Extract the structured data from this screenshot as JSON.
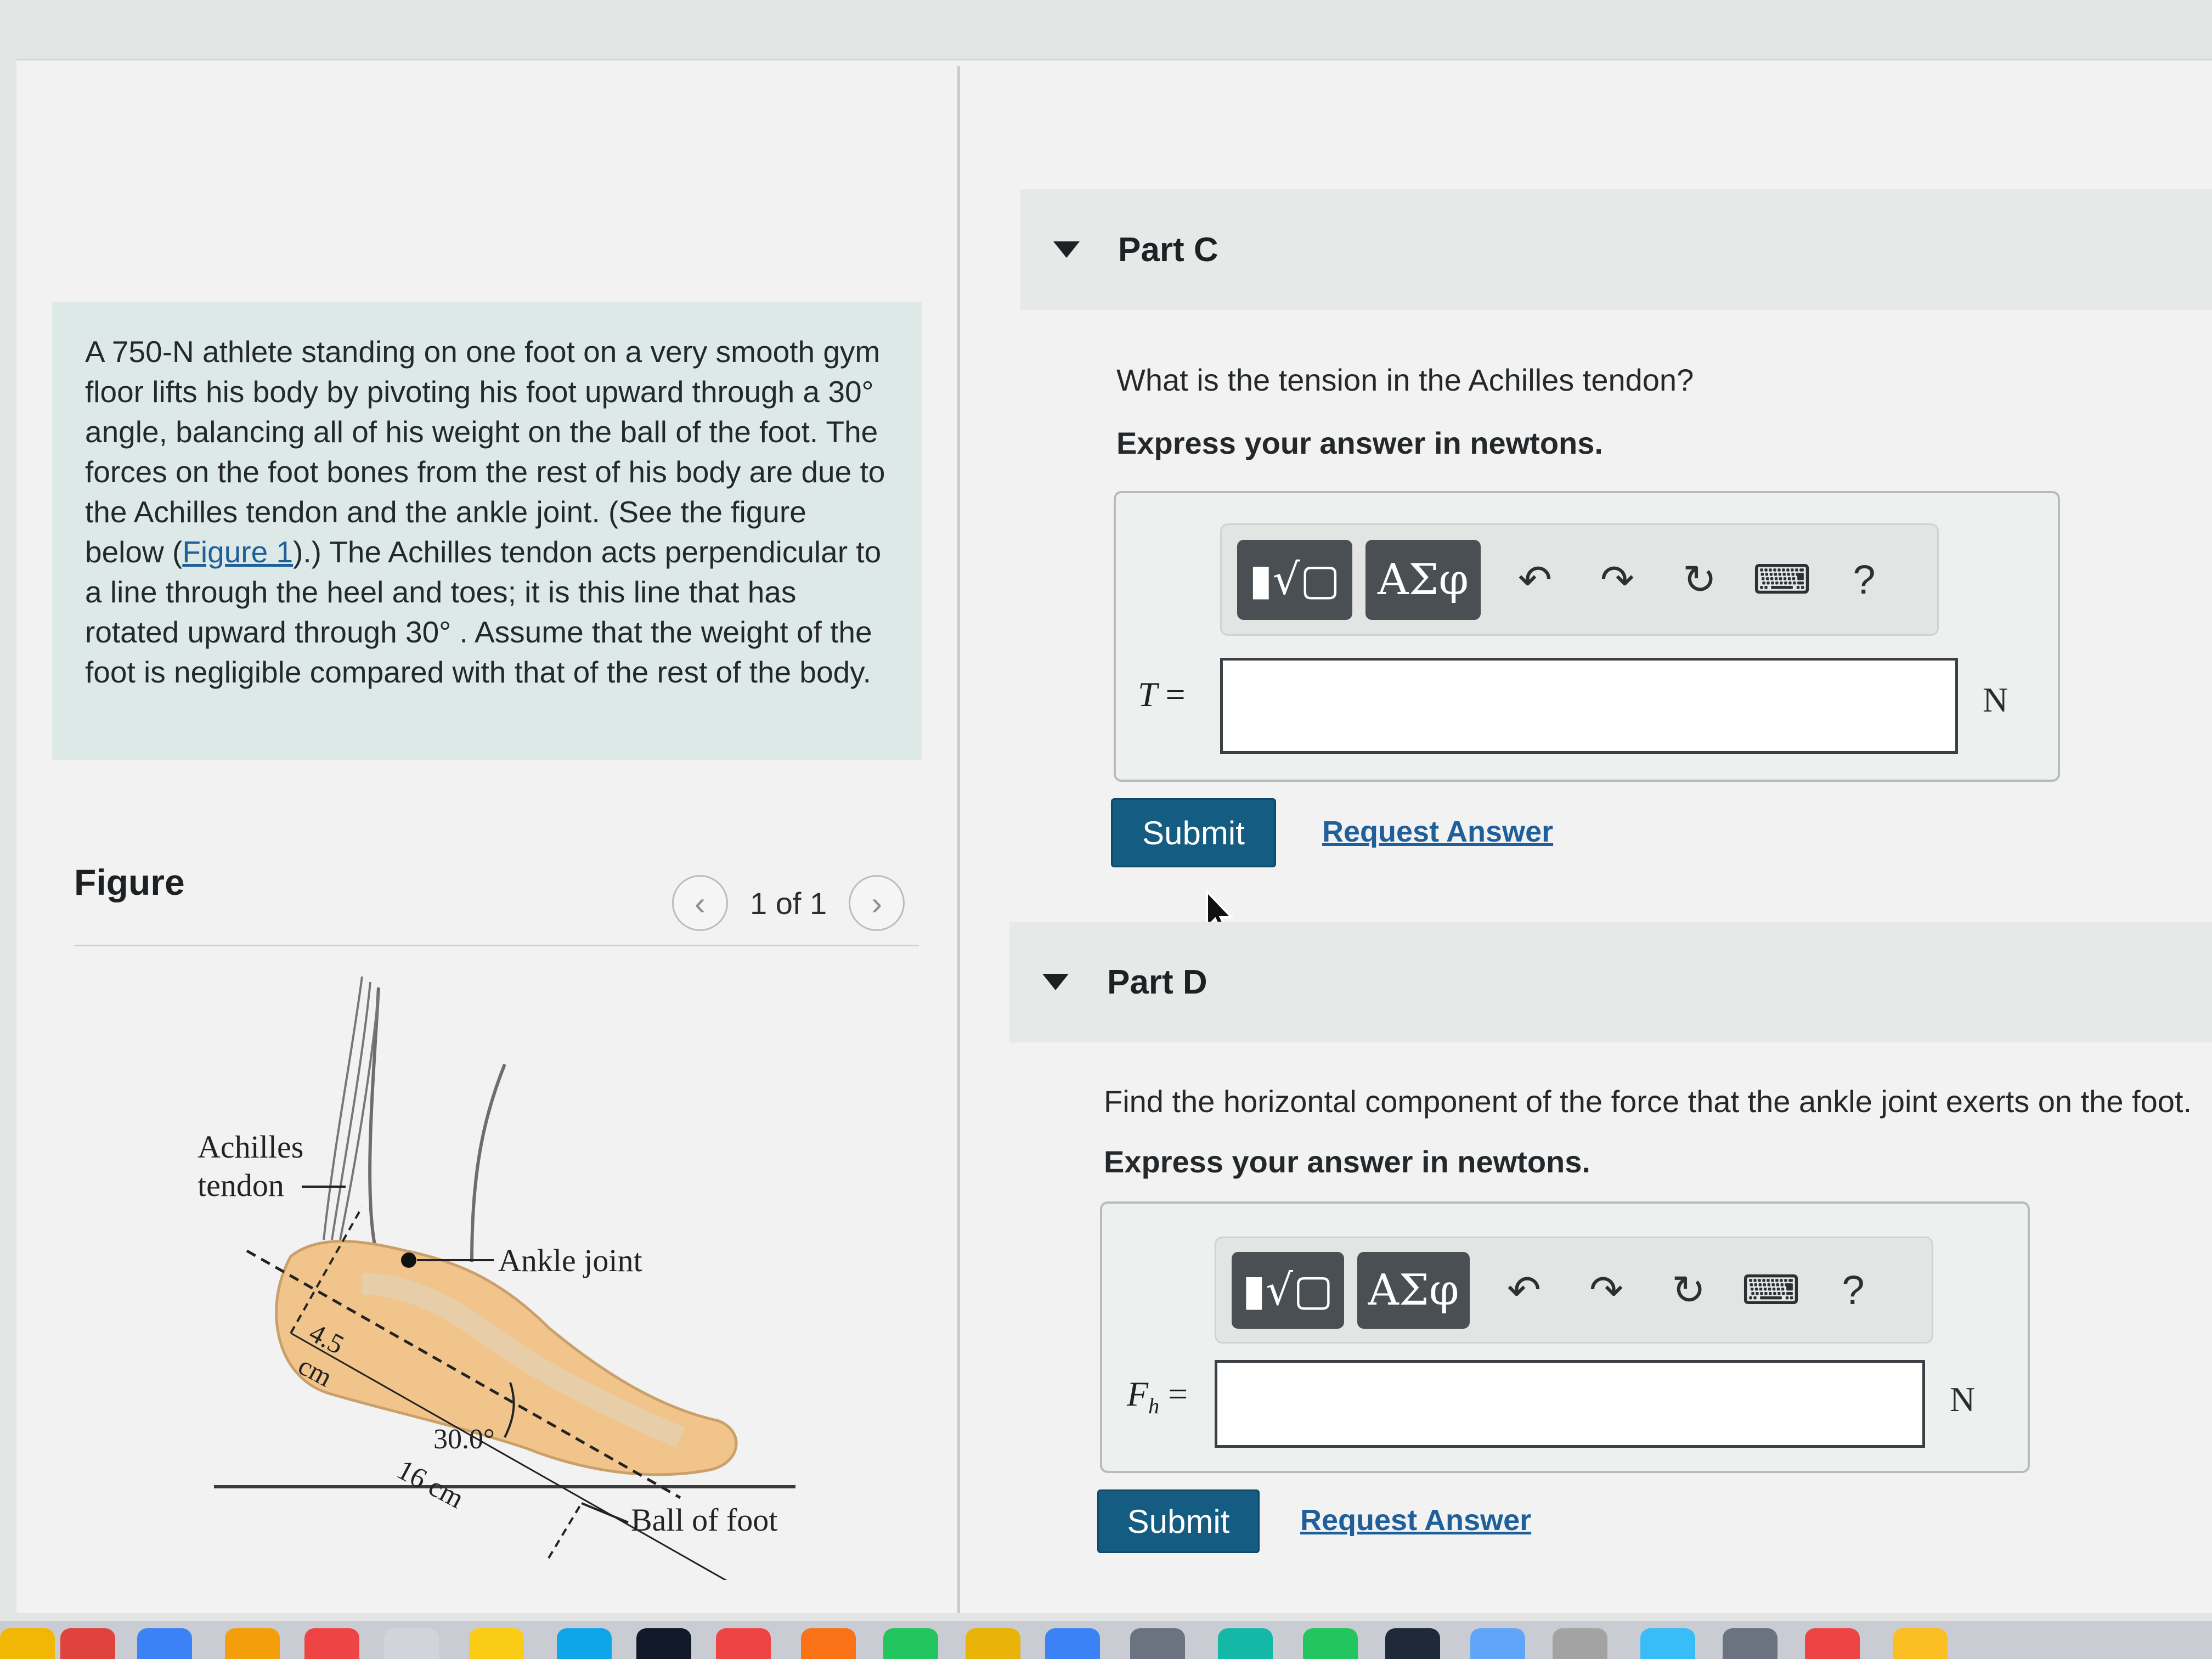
{
  "problem": {
    "text_before_link": "A 750-N athlete standing on one foot on a very smooth gym floor lifts his body by pivoting his foot upward through a 30° angle, balancing all of his weight on the ball of the foot. The forces on the foot bones from the rest of his body are due to the Achilles tendon and the ankle joint. (See the figure below (",
    "link": "Figure 1",
    "text_after_link": ").) The Achilles tendon acts perpendicular to a line through the heel and toes; it is this line that has rotated upward through 30° . Assume that the weight of the foot is negligible compared with that of the rest of the body."
  },
  "figure": {
    "title": "Figure",
    "pager": "1 of 1",
    "labels": {
      "tendon_line1": "Achilles",
      "tendon_line2": "tendon",
      "ankle": "Ankle joint",
      "dist1_a": "4.5",
      "dist1_b": "cm",
      "angle": "30.0°",
      "dist2": "16 cm",
      "ball": "Ball of foot"
    }
  },
  "toolbar": {
    "templates_icon": "fraction-sqrt-template-icon",
    "greek": "ΑΣφ",
    "help": "?"
  },
  "parts": [
    {
      "title": "Part C",
      "question": "What is the tension in the Achilles tendon?",
      "express": "Express your answer in newtons.",
      "var": "T",
      "eq": "=",
      "unit": "N",
      "value": "",
      "submit": "Submit",
      "request": "Request Answer"
    },
    {
      "title": "Part D",
      "question": "Find the horizontal component of the force that the ankle joint exerts on the foot.",
      "express": "Express your answer in newtons.",
      "var": "F",
      "sub": "h",
      "eq": "=",
      "unit": "N",
      "value": "",
      "submit": "Submit",
      "request": "Request Answer"
    }
  ],
  "colors": {
    "submit": "#145c82",
    "link": "#1f5f9a",
    "intro_bg": "#dde9e6"
  }
}
